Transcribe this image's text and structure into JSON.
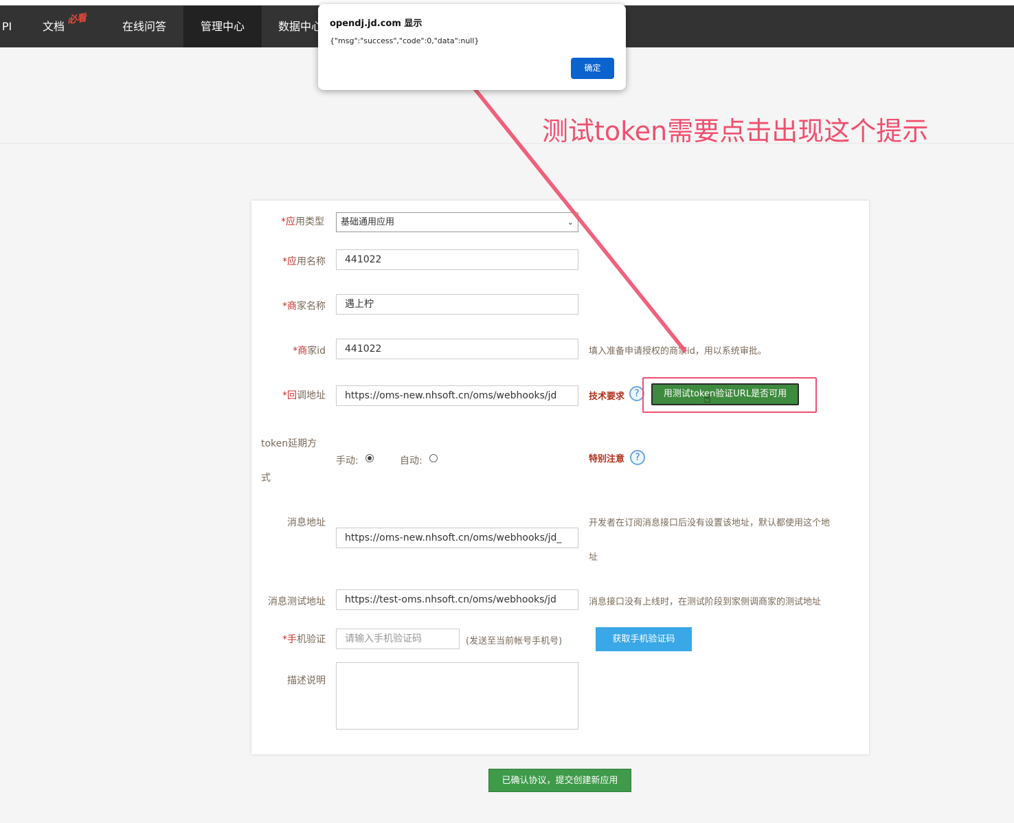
{
  "nav": {
    "items": [
      {
        "label": "PI"
      },
      {
        "label": "文档"
      },
      {
        "label": "在线问答"
      },
      {
        "label": "管理中心"
      },
      {
        "label": "数据中心"
      }
    ],
    "hot_badge": "必看"
  },
  "alert": {
    "title": "opendj.jd.com 显示",
    "message": "{\"msg\":\"success\",\"code\":0,\"data\":null}",
    "ok_label": "确定"
  },
  "annotation": {
    "text": "测试token需要点击出现这个提示",
    "color": "#f0506e"
  },
  "form": {
    "app_type_label": "*应用类型",
    "app_type_value": "基础通用应用",
    "app_name_label": "*应用名称",
    "app_name_value": "441022",
    "merchant_name_label": "*商家名称",
    "merchant_name_value": "遇上柠",
    "merchant_id_label": "*商家id",
    "merchant_id_value": "441022",
    "merchant_id_hint": "填入准备申请授权的商家id，用以系统审批。",
    "callback_label": "*回调地址",
    "callback_value": "https://oms-new.nhsoft.cn/oms/webhooks/jd",
    "tech_req_label": "技术要求",
    "test_token_button": "用测试token验证URL是否可用",
    "token_label_line1": "token延期方",
    "token_label_line2": "式",
    "manual_label": "手动:",
    "auto_label": "自动:",
    "special_note_label": "特别注意",
    "msg_addr_label": "消息地址",
    "msg_addr_value": "https://oms-new.nhsoft.cn/oms/webhooks/jd_",
    "msg_addr_hint_line1": "开发者在订阅消息接口后没有设置该地址，默认都使用这个地",
    "msg_addr_hint_line2": "址",
    "msg_test_label": "消息测试地址",
    "msg_test_value": "https://test-oms.nhsoft.cn/oms/webhooks/jd",
    "msg_test_hint": "消息接口没有上线时，在测试阶段到家侧调商家的测试地址",
    "phone_label": "*手机验证",
    "phone_placeholder": "请输入手机验证码",
    "phone_hint": "(发送至当前帐号手机号)",
    "get_code_button": "获取手机验证码",
    "desc_label": "描述说明",
    "submit_button": "已确认协议，提交创建新应用"
  },
  "colors": {
    "nav_bg": "#333333",
    "green_button": "#3e8a3e",
    "blue_button": "#3aa7e6",
    "alert_ok": "#0b63ce",
    "required_star": "#c9302c"
  }
}
